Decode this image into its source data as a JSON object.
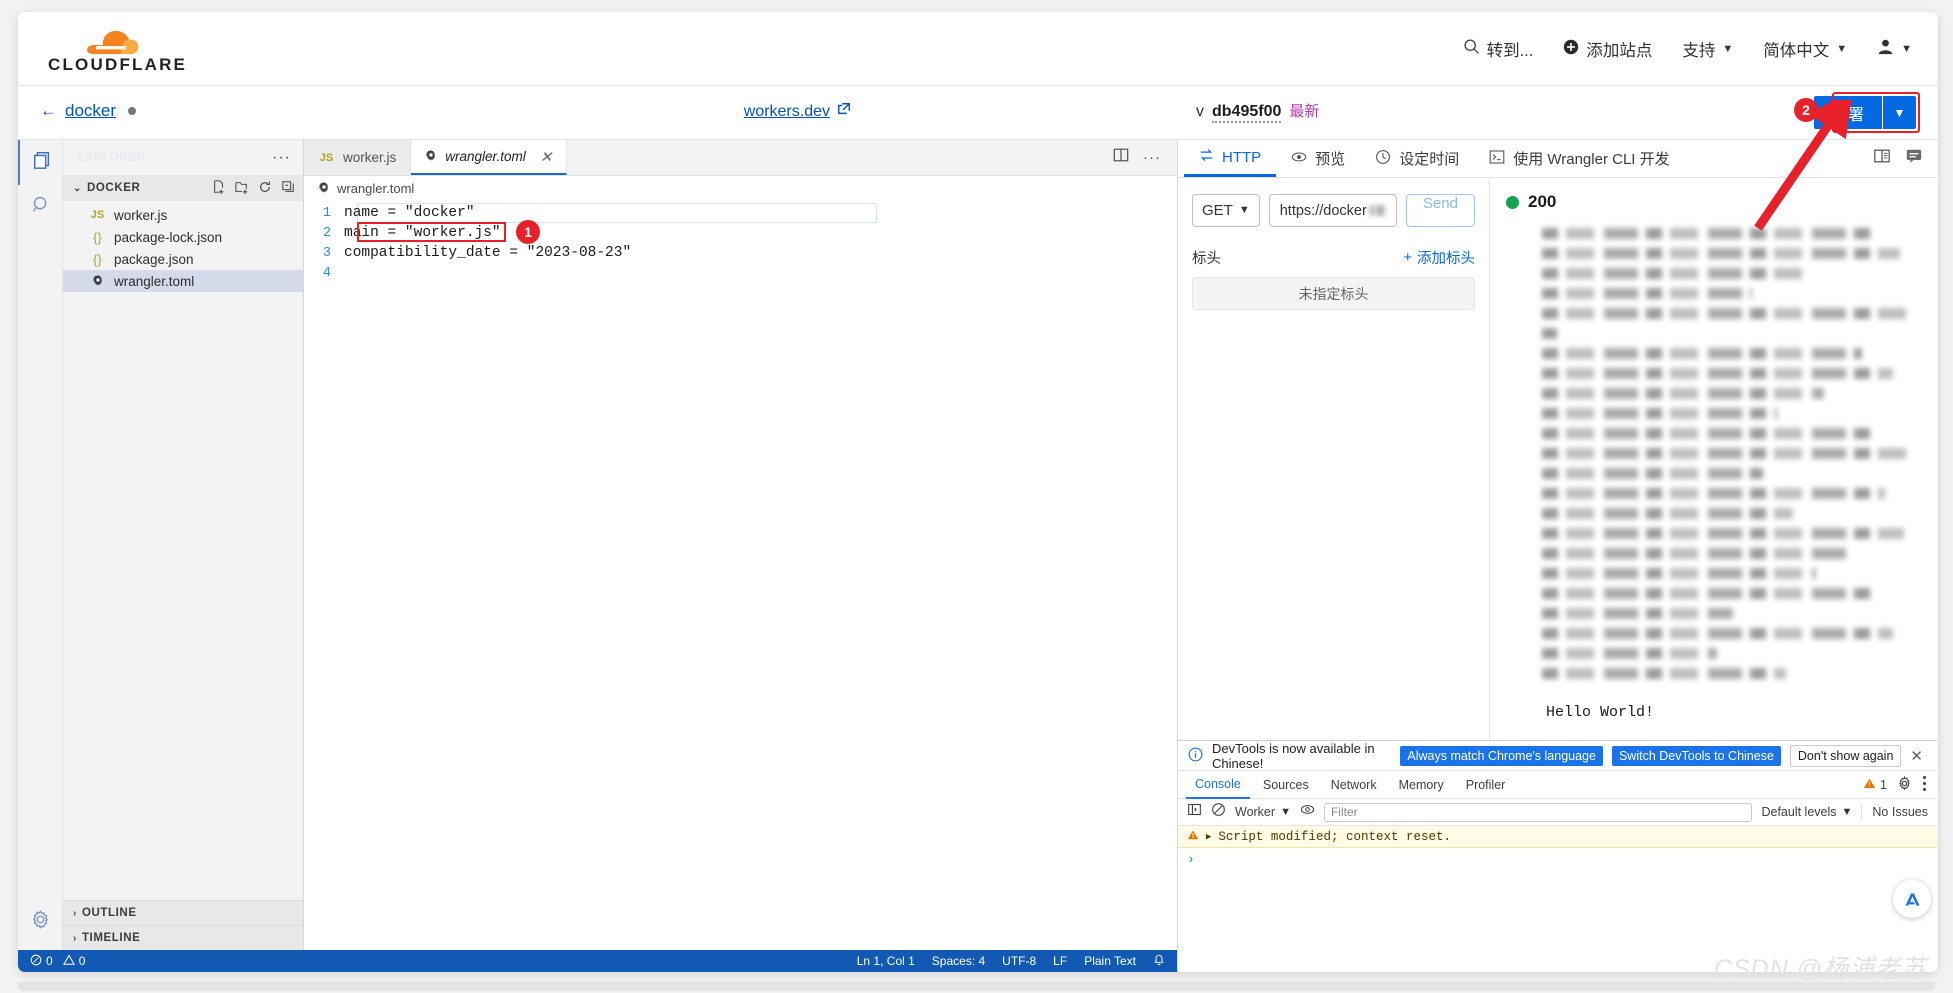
{
  "topbar": {
    "logo_text": "CLOUDFLARE",
    "nav": [
      {
        "icon": "search-icon",
        "label": "转到..."
      },
      {
        "icon": "plus-circle-icon",
        "label": "添加站点"
      },
      {
        "icon": "",
        "label": "支持",
        "caret": "▼"
      },
      {
        "icon": "",
        "label": "简体中文",
        "caret": "▼"
      },
      {
        "icon": "user-icon",
        "label": "",
        "caret": "▼"
      }
    ]
  },
  "subbar": {
    "back_arrow": "←",
    "back_label": "docker",
    "workers_dev_label": "workers.dev",
    "version_prefix": "v",
    "version_hash": "db495f00",
    "version_latest": "最新",
    "deploy_label": "部署",
    "deploy_caret": "▼",
    "marker_2": "2"
  },
  "vscode": {
    "activity_icons": [
      "files-icon",
      "search-icon",
      "settings-gear-icon"
    ],
    "explorer_title": "EXPLORER",
    "explorer_menu": "···",
    "folder": {
      "name": "DOCKER",
      "chevron": "⌄",
      "actions": [
        "new-file-icon",
        "new-folder-icon",
        "refresh-icon",
        "collapse-all-icon"
      ]
    },
    "files": [
      {
        "name": "worker.js",
        "icon": "JS",
        "kind": "js",
        "selected": false
      },
      {
        "name": "package-lock.json",
        "icon": "{}",
        "kind": "json",
        "selected": false
      },
      {
        "name": "package.json",
        "icon": "{}",
        "kind": "json",
        "selected": false
      },
      {
        "name": "wrangler.toml",
        "icon": "✿",
        "kind": "toml",
        "selected": true
      }
    ],
    "bottom_sections": [
      {
        "label": "OUTLINE",
        "chevron": "›"
      },
      {
        "label": "TIMELINE",
        "chevron": "›"
      }
    ],
    "tabs": [
      {
        "label": "worker.js",
        "icon": "JS",
        "active": false,
        "closable": false
      },
      {
        "label": "wrangler.toml",
        "icon": "✿",
        "active": true,
        "closable": true,
        "close": "✕"
      }
    ],
    "tabbar_actions": [
      "split-editor-icon",
      "more-actions-icon"
    ],
    "breadcrumb": "wrangler.toml",
    "code_lines": [
      {
        "no": "1",
        "text": "name = \"docker\""
      },
      {
        "no": "2",
        "text": "main = \"worker.js\""
      },
      {
        "no": "3",
        "text": "compatibility_date = \"2023-08-23\""
      },
      {
        "no": "4",
        "text": ""
      }
    ],
    "marker_1": "1",
    "status_bar": {
      "errors_icon": "error-icon",
      "errors": "0",
      "warnings_icon": "warning-icon",
      "warnings": "0",
      "cursor": "Ln 1, Col 1",
      "spaces": "Spaces: 4",
      "encoding": "UTF-8",
      "eol": "LF",
      "language": "Plain Text",
      "bell": "bell-icon"
    }
  },
  "right_panel": {
    "tabs": [
      {
        "label": "HTTP",
        "icon": "http-swap-icon",
        "active": true
      },
      {
        "label": "预览",
        "icon": "eye-icon",
        "active": false
      },
      {
        "label": "设定时间",
        "icon": "clock-icon",
        "active": false
      },
      {
        "label": "使用 Wrangler CLI 开发",
        "icon": "terminal-icon",
        "active": false
      }
    ],
    "tabs_right_icons": [
      "docs-book-icon",
      "feedback-chat-icon"
    ],
    "request": {
      "method": "GET",
      "method_caret": "▼",
      "url_value": "https://docker",
      "send_label": "Send",
      "headers_label": "标头",
      "add_header_label": "添加标头",
      "add_header_icon": "+",
      "no_headers_label": "未指定标头"
    },
    "response": {
      "status_code": "200",
      "status_color": "#14a44d",
      "body_text": "Hello World!",
      "blurred_line_count": 24
    }
  },
  "devtools": {
    "banner": {
      "icon": "info-icon",
      "message": "DevTools is now available in Chinese!",
      "primary_btn": "Always match Chrome's language",
      "secondary_btn": "Switch DevTools to Chinese",
      "dismiss_btn": "Don't show again",
      "close": "✕"
    },
    "tabs": [
      {
        "label": "Console",
        "active": true
      },
      {
        "label": "Sources",
        "active": false
      },
      {
        "label": "Network",
        "active": false
      },
      {
        "label": "Memory",
        "active": false
      },
      {
        "label": "Profiler",
        "active": false
      }
    ],
    "warning_count": "1",
    "settings_icon": "gear-icon",
    "more_icon": "kebab-menu-icon",
    "toolbar": {
      "sidebar_icon": "console-sidebar-icon",
      "clear_icon": "clear-console-icon",
      "context": "Worker",
      "context_caret": "▼",
      "eye_icon": "live-expression-icon",
      "filter_placeholder": "Filter",
      "levels": "Default levels",
      "levels_caret": "▼",
      "issues": "No Issues"
    },
    "messages": [
      {
        "icon": "warning-icon",
        "expander": "▶",
        "text": "Script modified; context reset."
      }
    ],
    "prompt": "›"
  },
  "watermark": "CSDN @杨浦老苏"
}
